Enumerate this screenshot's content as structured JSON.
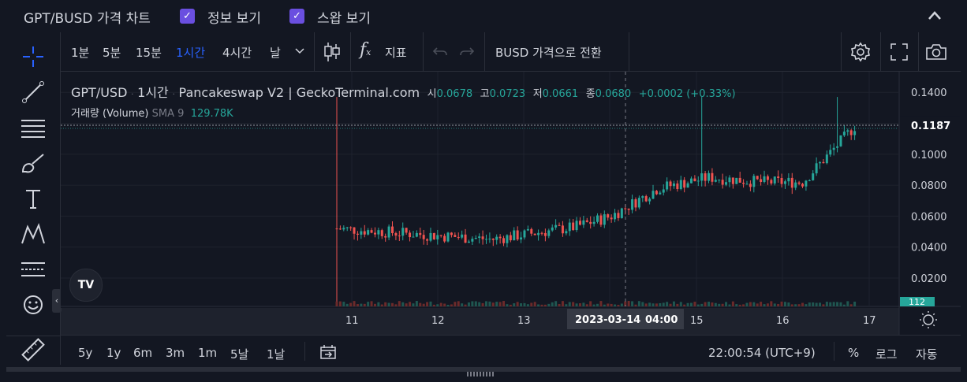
{
  "header": {
    "title": "GPT/BUSD 가격 차트",
    "check1": "정보 보기",
    "check2": "스왑 보기"
  },
  "toolbar": {
    "intervals": [
      "1분",
      "5분",
      "15분",
      "1시간",
      "4시간",
      "날"
    ],
    "indicators_label": "지표",
    "convert_label": "BUSD 가격으로 전환"
  },
  "legend": {
    "pair": "GPT/USD",
    "interval": "1시간",
    "source": "Pancakeswap V2 | GeckoTerminal.com",
    "o_label": "시",
    "o": "0.0678",
    "h_label": "고",
    "h": "0.0723",
    "l_label": "저",
    "l": "0.0661",
    "c_label": "종",
    "c": "0.0680",
    "change": "+0.0002 (+0.33%)",
    "volume_label": "거래량 (Volume)",
    "sma_label": "SMA 9",
    "sma_value": "129.78K"
  },
  "chart_data": {
    "type": "candlestick",
    "y_ticks": [
      "0.1400",
      "0.1200",
      "0.1000",
      "0.0800",
      "0.0600",
      "0.0400",
      "0.0200"
    ],
    "ylim": [
      0,
      0.15
    ],
    "x_ticks": [
      "11",
      "12",
      "13",
      "14",
      "15",
      "16",
      "17"
    ],
    "last_price": "0.1187",
    "volume_badge": "112",
    "crosshair_date": "2023-03-14",
    "crosshair_time": "04:00",
    "colors": {
      "up": "#26a69a",
      "down": "#ef5350"
    }
  },
  "bottom": {
    "ranges": [
      "5y",
      "1y",
      "6m",
      "3m",
      "1m",
      "5날",
      "1날"
    ],
    "clock": "22:00:54 (UTC+9)",
    "pct": "%",
    "log": "로그",
    "auto": "자동"
  }
}
